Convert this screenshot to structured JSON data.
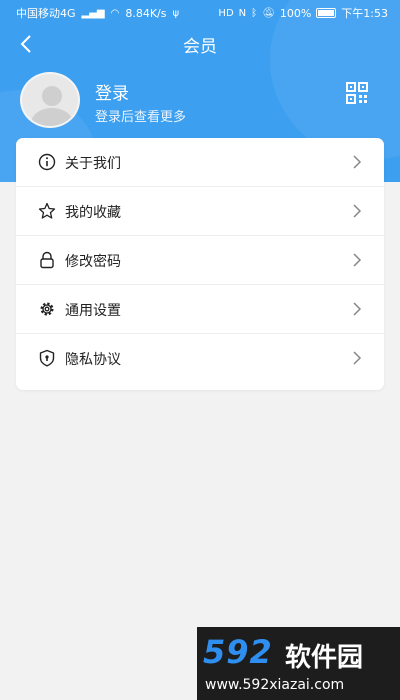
{
  "status_bar": {
    "carrier": "中国移动4G",
    "net_speed": "8.84K/s",
    "battery": "100%",
    "time": "下午1:53"
  },
  "nav": {
    "title": "会员"
  },
  "profile": {
    "login_label": "登录",
    "login_hint": "登录后查看更多"
  },
  "menu": {
    "items": [
      {
        "label": "关于我们",
        "icon": "info-icon"
      },
      {
        "label": "我的收藏",
        "icon": "star-icon"
      },
      {
        "label": "修改密码",
        "icon": "lock-icon"
      },
      {
        "label": "通用设置",
        "icon": "gear-icon"
      },
      {
        "label": "隐私协议",
        "icon": "shield-icon"
      }
    ]
  },
  "watermark": {
    "brand_number": "592",
    "brand_name": "软件园",
    "url": "www.592xiazai.com"
  },
  "colors": {
    "header": "#3c9ff0",
    "background": "#f2f2f2",
    "card": "#ffffff"
  }
}
